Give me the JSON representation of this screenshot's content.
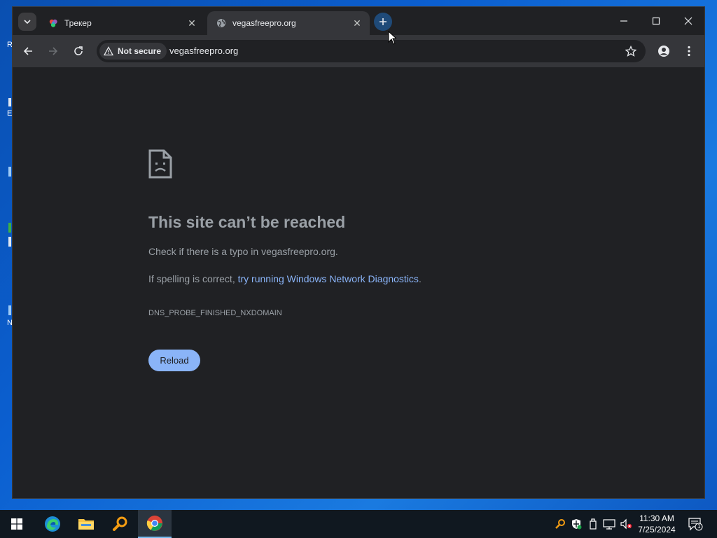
{
  "browser": {
    "tabs": [
      {
        "title": "Трекер",
        "active": false
      },
      {
        "title": "vegasfreepro.org",
        "active": true
      }
    ],
    "security_chip": "Not secure",
    "url": "vegasfreepro.org"
  },
  "error_page": {
    "title": "This site can’t be reached",
    "check_line": "Check if there is a typo in vegasfreepro.org.",
    "spelling_prefix": "If spelling is correct, ",
    "diagnostics_link": "try running Windows Network Diagnostics",
    "spelling_suffix": ".",
    "error_code": "DNS_PROBE_FINISHED_NXDOMAIN",
    "reload_label": "Reload"
  },
  "desktop": {
    "sliver_letters": [
      "R",
      "E",
      "N"
    ]
  },
  "taskbar": {
    "time": "11:30 AM",
    "date": "7/25/2024",
    "notification_count": "1",
    "pinned": [
      "start",
      "edge",
      "file-explorer",
      "search-tool",
      "chrome"
    ]
  },
  "colors": {
    "page_bg": "#202124",
    "toolbar_bg": "#35363a",
    "link": "#8ab4f8",
    "text_muted": "#9aa0a6",
    "taskbar": "#101820"
  }
}
